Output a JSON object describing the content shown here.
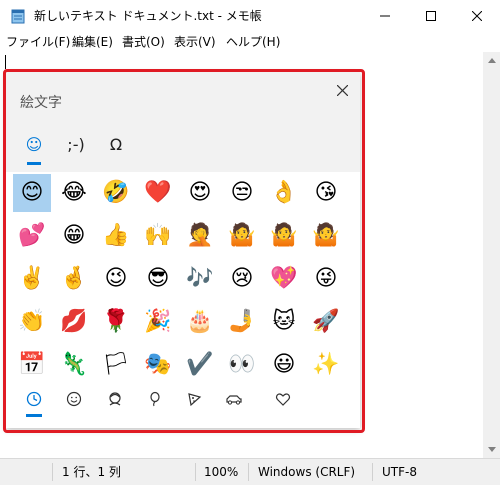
{
  "window": {
    "title": "新しいテキスト ドキュメント.txt - メモ帳"
  },
  "menu": [
    {
      "label": "ファイル(F)"
    },
    {
      "label": "編集(E)"
    },
    {
      "label": "書式(O)"
    },
    {
      "label": "表示(V)"
    },
    {
      "label": "ヘルプ(H)"
    }
  ],
  "status": {
    "position": "1 行、1 列",
    "zoom": "100%",
    "line_ending": "Windows (CRLF)",
    "encoding": "UTF-8"
  },
  "emoji_panel": {
    "title": "絵文字",
    "tabs": [
      {
        "label": "☺",
        "name": "emoji"
      },
      {
        "label": ";-)",
        "name": "kaomoji"
      },
      {
        "label": "Ω",
        "name": "symbols"
      }
    ],
    "emojis": [
      [
        "😊",
        "😂",
        "🤣",
        "❤️",
        "😍",
        "😒",
        "👌",
        "😘"
      ],
      [
        "💕",
        "😁",
        "👍",
        "🙌",
        "🤦",
        "🤷",
        "🤷",
        "🤷"
      ],
      [
        "✌️",
        "🤞",
        "😉",
        "😎",
        "🎶",
        "😢",
        "💖",
        "😜"
      ],
      [
        "👏",
        "💋",
        "🌹",
        "🎉",
        "🎂",
        "🤳",
        "🐱",
        "🚀"
      ],
      [
        "📅",
        "🦎",
        "🏳",
        "🎭",
        "✔️",
        "👀",
        "😃",
        "✨"
      ]
    ],
    "categories": [
      {
        "name": "recent",
        "icon": "clock-icon"
      },
      {
        "name": "smileys",
        "icon": "smiley-icon"
      },
      {
        "name": "people",
        "icon": "person-icon"
      },
      {
        "name": "celebration",
        "icon": "balloon-icon"
      },
      {
        "name": "food",
        "icon": "pizza-icon"
      },
      {
        "name": "travel",
        "icon": "car-icon"
      },
      {
        "name": "symbols",
        "icon": "heart-icon"
      }
    ]
  },
  "colors": {
    "accent": "#0078d7",
    "highlight_border": "#e01b24"
  }
}
